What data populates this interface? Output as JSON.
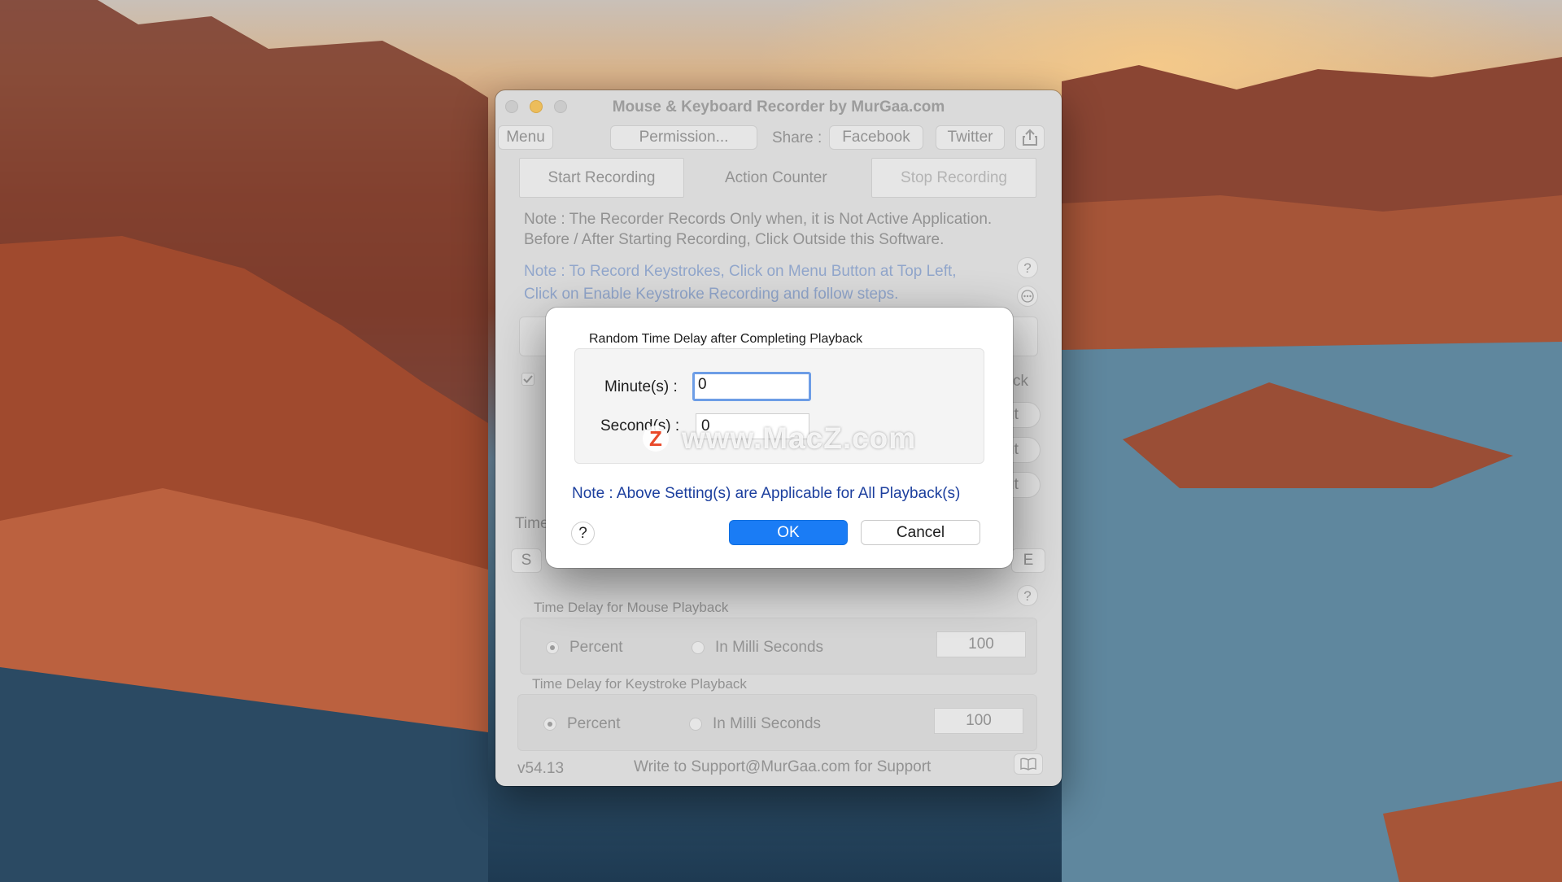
{
  "window": {
    "title": "Mouse & Keyboard Recorder by MurGaa.com",
    "toolbar": {
      "menu": "Menu",
      "permission": "Permission...",
      "share_label": "Share :",
      "facebook": "Facebook",
      "twitter": "Twitter"
    },
    "start_recording": "Start Recording",
    "action_counter": "Action Counter",
    "stop_recording": "Stop Recording",
    "note1_line1": "Note : The Recorder Records Only when, it is Not Active Application.",
    "note1_line2": "Before / After Starting Recording, Click Outside this Software.",
    "note2_line1": "Note : To Record Keystrokes, Click on Menu Button at Top Left,",
    "note2_line2": "Click on Enable Keystroke Recording and follow steps.",
    "partial_right_1": "ck",
    "partial_right_2": "ut",
    "partial_right_3": "ut",
    "partial_right_4": "ut",
    "time_partial": "Time",
    "s_btn": "S",
    "e_btn": "E",
    "mouse_delay": {
      "title": "Time Delay for Mouse Playback",
      "percent": "Percent",
      "milli": "In Milli Seconds",
      "value": "100"
    },
    "key_delay": {
      "title": "Time Delay for Keystroke Playback",
      "percent": "Percent",
      "milli": "In Milli Seconds",
      "value": "100"
    },
    "version": "v54.13",
    "support": "Write to Support@MurGaa.com for Support"
  },
  "dialog": {
    "title": "Random Time Delay after Completing Playback",
    "minutes_label": "Minute(s) :",
    "minutes_value": "0",
    "seconds_label": "Second(s) :",
    "seconds_value": "0",
    "note": "Note : Above Setting(s) are Applicable for All Playback(s)",
    "help": "?",
    "ok": "OK",
    "cancel": "Cancel"
  },
  "watermark": "www.MacZ.com",
  "watermark_logo": "Z",
  "help_glyph": "?",
  "colors": {
    "accent": "#1a7cf5",
    "note_blue": "#1c3f9e",
    "window_bg": "#dcdcdc"
  }
}
